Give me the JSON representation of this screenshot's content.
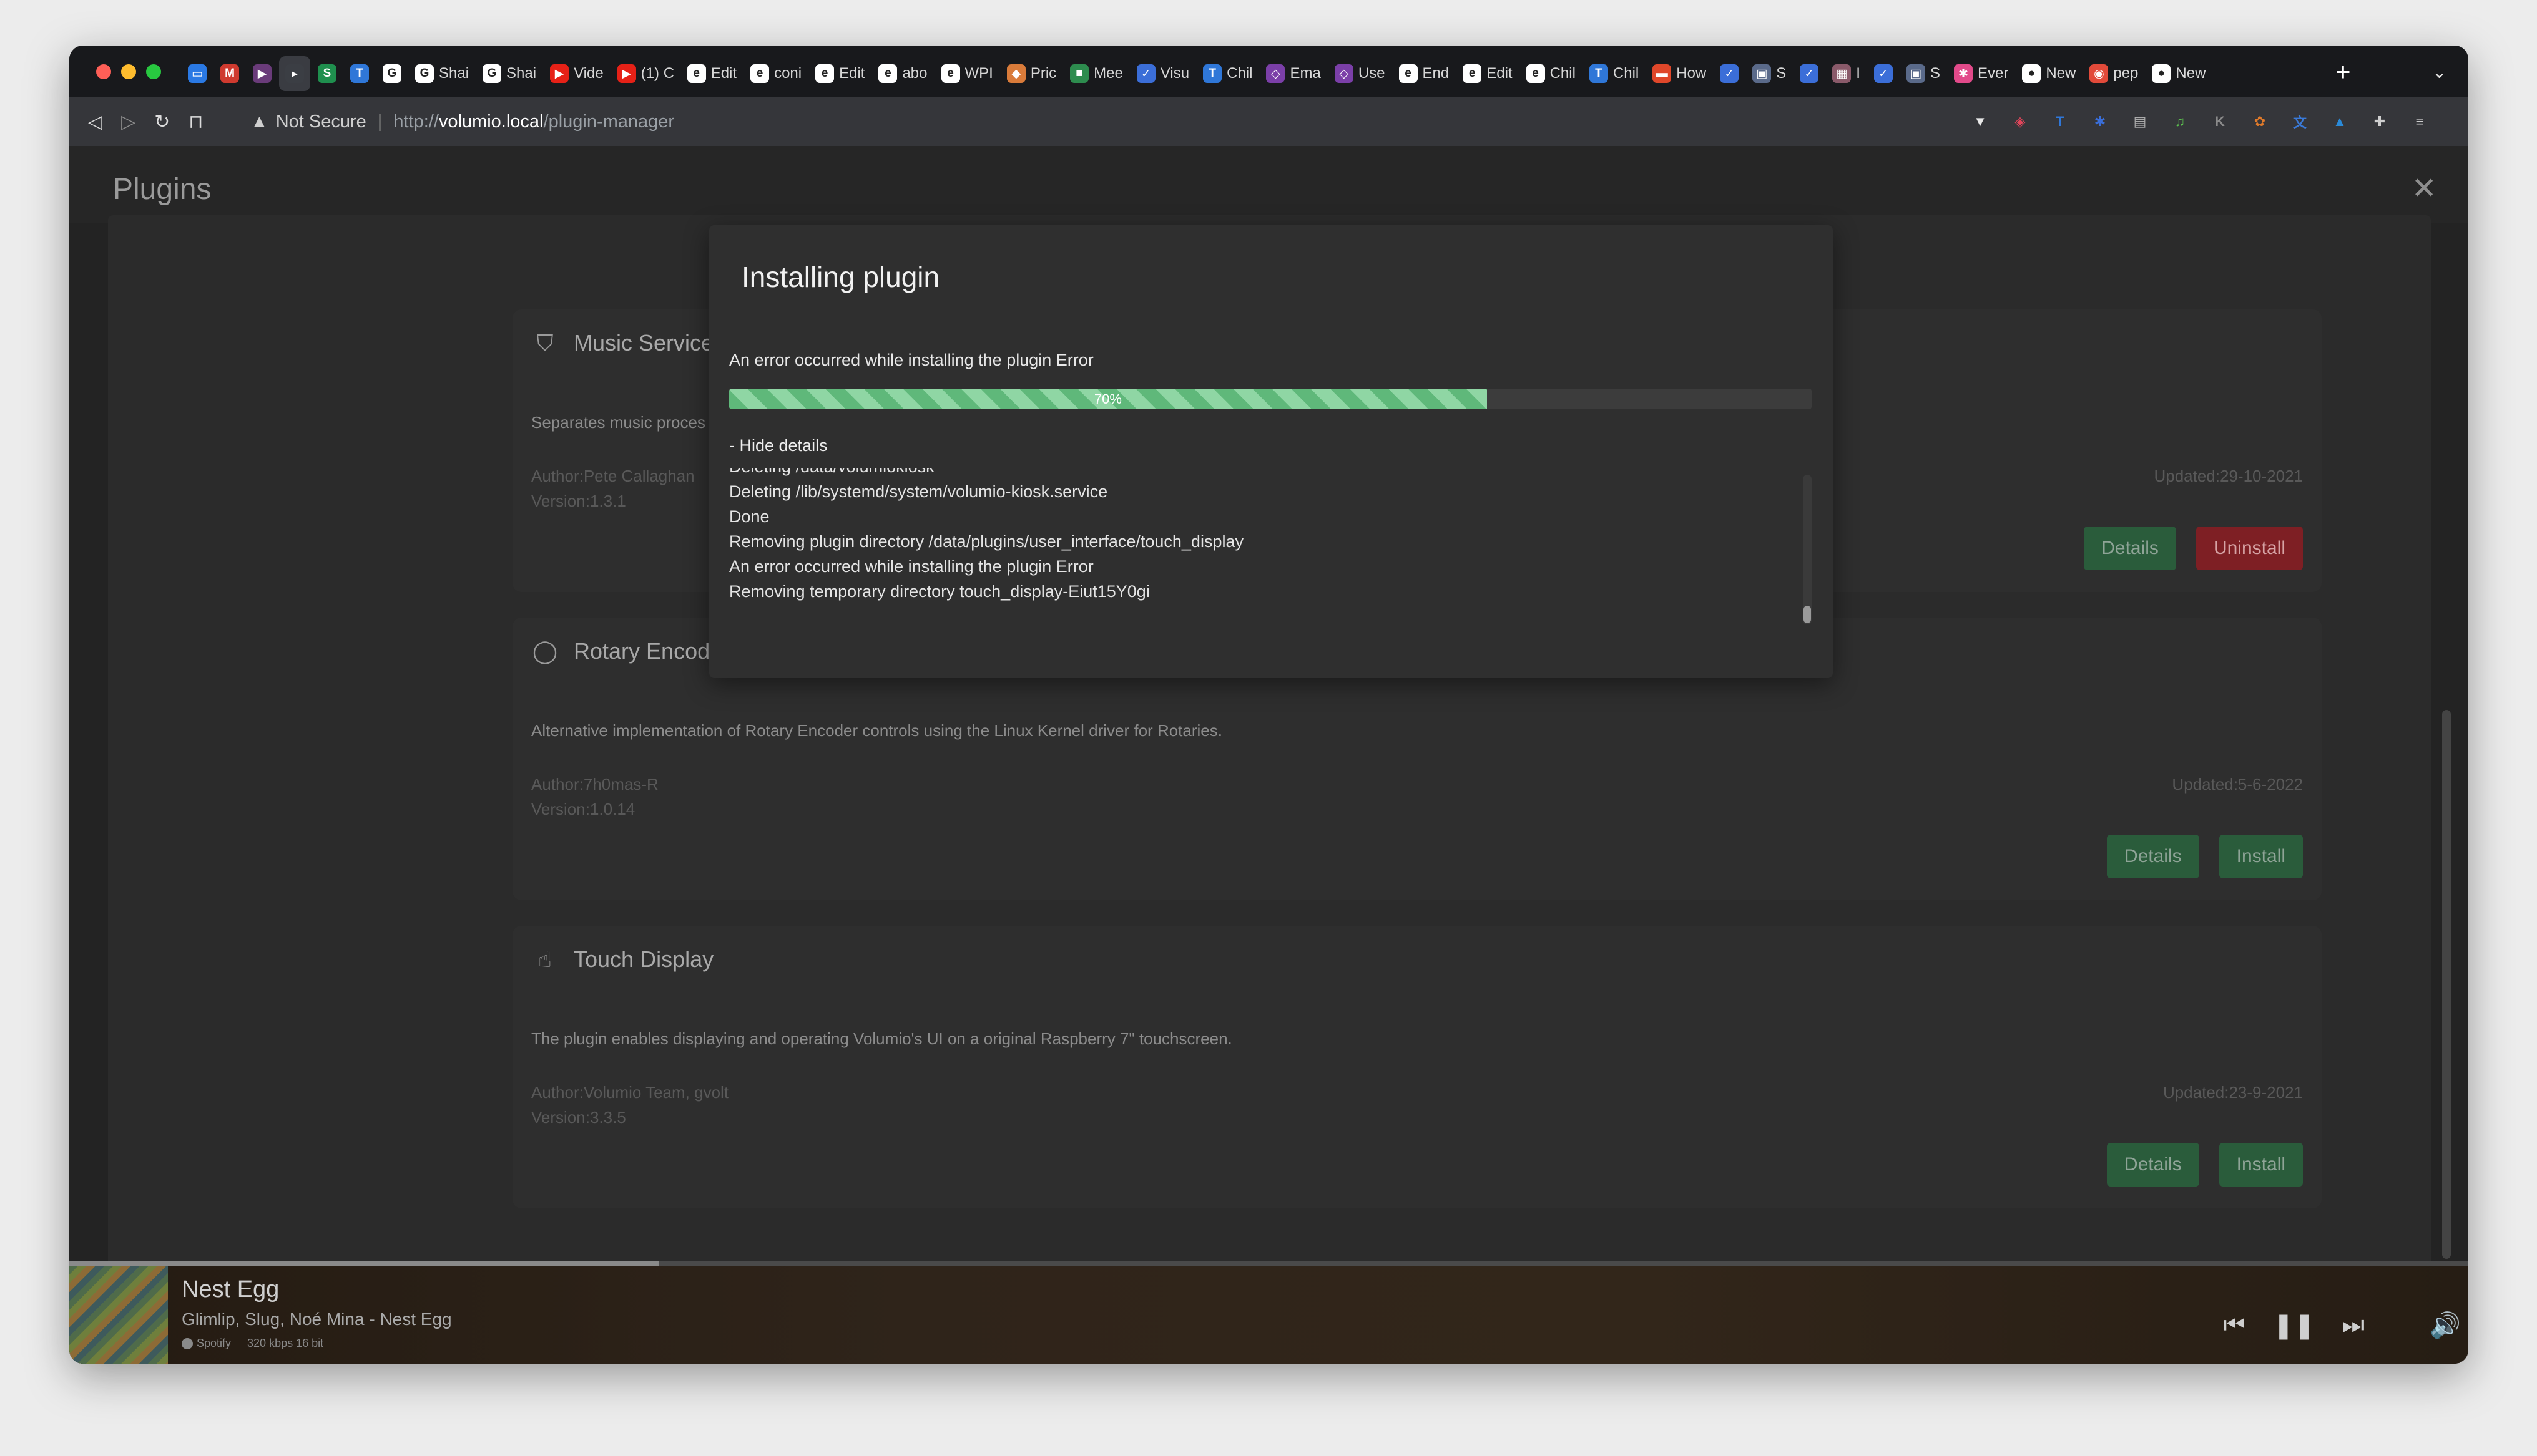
{
  "browser": {
    "tabs": [
      {
        "label": "",
        "color": "#2a79e4",
        "glyph": "▭"
      },
      {
        "label": "",
        "color": "#cf3a2f",
        "glyph": "M"
      },
      {
        "label": "",
        "color": "#6a3b7a",
        "glyph": "▶"
      },
      {
        "label": "",
        "color": "#3b3e44",
        "glyph": "▸",
        "active": true
      },
      {
        "label": "",
        "color": "#1f8f4e",
        "glyph": "S"
      },
      {
        "label": "",
        "color": "#2f77d8",
        "glyph": "T"
      },
      {
        "label": "",
        "color": "#ffffff",
        "glyph": "G"
      },
      {
        "label": "Shai",
        "color": "#ffffff",
        "glyph": "G"
      },
      {
        "label": "Shai",
        "color": "#ffffff",
        "glyph": "G"
      },
      {
        "label": "Vide",
        "color": "#e62117",
        "glyph": "▶"
      },
      {
        "label": "(1) C",
        "color": "#e62117",
        "glyph": "▶"
      },
      {
        "label": "Edit",
        "color": "#ffffff",
        "glyph": "e"
      },
      {
        "label": "coni",
        "color": "#ffffff",
        "glyph": "e"
      },
      {
        "label": "Edit",
        "color": "#ffffff",
        "glyph": "e"
      },
      {
        "label": "abo",
        "color": "#ffffff",
        "glyph": "e"
      },
      {
        "label": "WPI",
        "color": "#ffffff",
        "glyph": "e"
      },
      {
        "label": "Pric",
        "color": "#d97b3a",
        "glyph": "◆"
      },
      {
        "label": "Mee",
        "color": "#2d8c4e",
        "glyph": "■"
      },
      {
        "label": "Visu",
        "color": "#3b6ed8",
        "glyph": "✓"
      },
      {
        "label": "Chil",
        "color": "#2f77d8",
        "glyph": "T"
      },
      {
        "label": "Ema",
        "color": "#7b3fa8",
        "glyph": "◇"
      },
      {
        "label": "Use",
        "color": "#7b3fa8",
        "glyph": "◇"
      },
      {
        "label": "End",
        "color": "#ffffff",
        "glyph": "e"
      },
      {
        "label": "Edit",
        "color": "#ffffff",
        "glyph": "e"
      },
      {
        "label": "Chil",
        "color": "#ffffff",
        "glyph": "e"
      },
      {
        "label": "Chil",
        "color": "#2f77d8",
        "glyph": "T"
      },
      {
        "label": "How",
        "color": "#e0472a",
        "glyph": "▬"
      },
      {
        "label": "",
        "color": "#3b6ed8",
        "glyph": "✓"
      },
      {
        "label": "S",
        "color": "#5a6a8a",
        "glyph": "▣"
      },
      {
        "label": "",
        "color": "#3b6ed8",
        "glyph": "✓"
      },
      {
        "label": "I",
        "color": "#8a5a6a",
        "glyph": "▦"
      },
      {
        "label": "",
        "color": "#3b6ed8",
        "glyph": "✓"
      },
      {
        "label": "S",
        "color": "#5a6a8a",
        "glyph": "▣"
      },
      {
        "label": "Ever",
        "color": "#e24a8a",
        "glyph": "✱"
      },
      {
        "label": "New",
        "color": "#ffffff",
        "glyph": "●"
      },
      {
        "label": "pep",
        "color": "#e24a3a",
        "glyph": "◉"
      },
      {
        "label": "New",
        "color": "#ffffff",
        "glyph": "●"
      }
    ],
    "address": {
      "security": "Not Secure",
      "url_scheme": "http://",
      "url_host": "volumio.local",
      "url_path": "/plugin-manager"
    },
    "extensions": [
      {
        "color": "#e8e8e8",
        "glyph": "▼"
      },
      {
        "color": "#e2455a",
        "glyph": "◈"
      },
      {
        "color": "#2f77d8",
        "glyph": "T"
      },
      {
        "color": "#3a6ed8",
        "glyph": "✱"
      },
      {
        "color": "#aaaaaa",
        "glyph": "▤"
      },
      {
        "color": "#5bbf4f",
        "glyph": "♫"
      },
      {
        "color": "#8a8a8a",
        "glyph": "K"
      },
      {
        "color": "#e07a2a",
        "glyph": "✿"
      },
      {
        "color": "#3a7ad8",
        "glyph": "文"
      },
      {
        "color": "#2a8ad8",
        "glyph": "▲"
      },
      {
        "color": "#cfcfcf",
        "glyph": "✚"
      },
      {
        "color": "#cfcfcf",
        "glyph": "≡"
      }
    ]
  },
  "page": {
    "title": "Plugins"
  },
  "plugins": [
    {
      "title": "Music Service",
      "icon": "shield-icon",
      "description": "Separates music proces",
      "author": "Author:Pete Callaghan",
      "version": "Version:1.3.1",
      "updated": "Updated:29-10-2021",
      "buttons": [
        {
          "label": "Details",
          "style": "green"
        },
        {
          "label": "Uninstall",
          "style": "red"
        }
      ]
    },
    {
      "title": "Rotary Encod",
      "icon": "circle-icon",
      "description": "Alternative implementation of Rotary Encoder controls using the Linux Kernel driver for Rotaries.",
      "author": "Author:7h0mas-R",
      "version": "Version:1.0.14",
      "updated": "Updated:5-6-2022",
      "buttons": [
        {
          "label": "Details",
          "style": "green"
        },
        {
          "label": "Install",
          "style": "green"
        }
      ]
    },
    {
      "title": "Touch Display",
      "icon": "hand-pointer-icon",
      "description": "The plugin enables displaying and operating Volumio's UI on a original Raspberry 7\" touchscreen.",
      "author": "Author:Volumio Team, gvolt",
      "version": "Version:3.3.5",
      "updated": "Updated:23-9-2021",
      "buttons": [
        {
          "label": "Details",
          "style": "green"
        },
        {
          "label": "Install",
          "style": "green"
        }
      ]
    }
  ],
  "modal": {
    "title": "Installing plugin",
    "status": "An error occurred while installing the plugin Error",
    "progress": 70,
    "progress_label": "70%",
    "toggle": "- Hide details",
    "log": [
      "Deleting /data/volumiokiosk",
      "Deleting /lib/systemd/system/volumio-kiosk.service",
      "Done",
      "Removing plugin directory /data/plugins/user_interface/touch_display",
      "An error occurred while installing the plugin Error",
      "Removing temporary directory touch_display-Eiut15Y0gi"
    ]
  },
  "player": {
    "title": "Nest Egg",
    "artist": "Glimlip, Slug, Noé Mina - Nest Egg",
    "service": "Spotify",
    "quality": "320 kbps 16 bit"
  }
}
